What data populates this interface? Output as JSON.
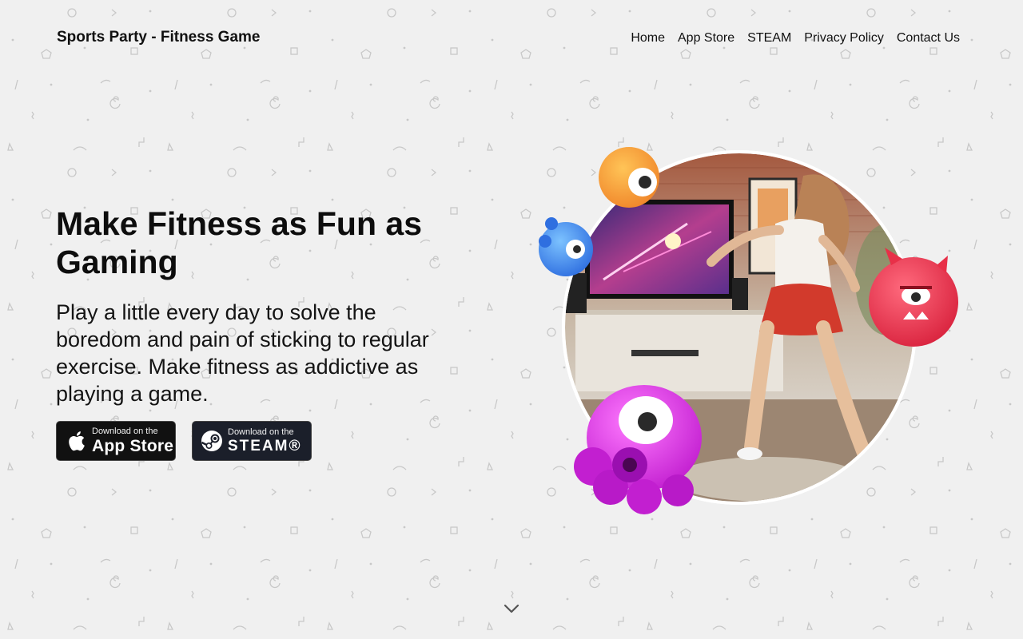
{
  "header": {
    "brand": "Sports Party - Fitness Game",
    "nav": [
      {
        "label": "Home"
      },
      {
        "label": "App Store"
      },
      {
        "label": "STEAM"
      },
      {
        "label": "Privacy Policy"
      },
      {
        "label": "Contact Us"
      }
    ]
  },
  "hero": {
    "title": "Make Fitness as Fun as Gaming",
    "subtitle": "Play a little every day to solve the boredom and pain of sticking to regular exercise. Make fitness as addictive as playing a game.",
    "badges": {
      "appstore": {
        "small": "Download on the",
        "big": "App Store",
        "icon": "apple-icon"
      },
      "steam": {
        "small": "Download on the",
        "big": "STEAM®",
        "icon": "steam-icon"
      }
    }
  },
  "illustration": {
    "description_icons": [
      "orange-monster",
      "blue-monster",
      "red-monster",
      "purple-monster"
    ]
  },
  "colors": {
    "background": "#f0f0f0",
    "text": "#111111",
    "badge": "#111111"
  }
}
